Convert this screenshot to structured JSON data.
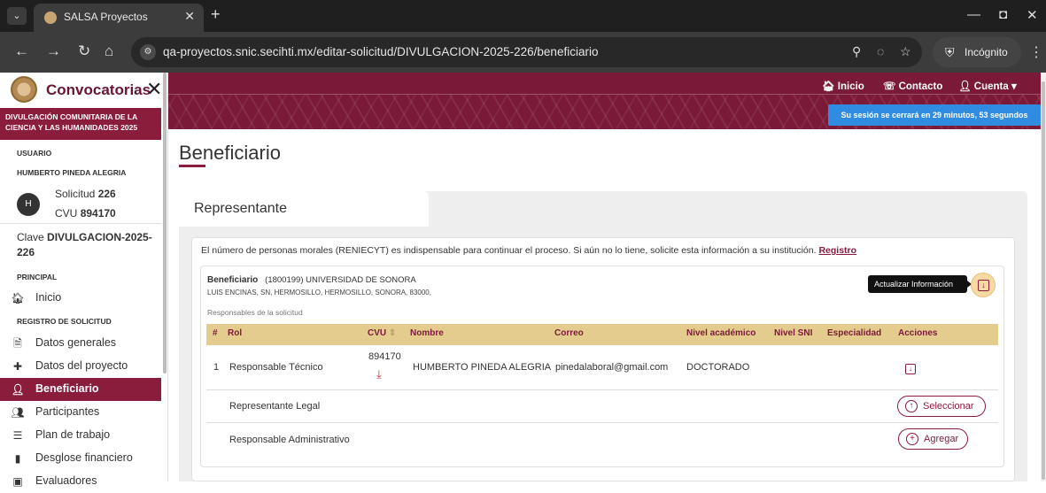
{
  "browser": {
    "tab_title": "SALSA Proyectos",
    "url": "qa-proyectos.snic.secihti.mx/editar-solicitud/DIVULGACION-2025-226/beneficiario",
    "incognito_label": "Incógnito"
  },
  "sidebar": {
    "title": "Convocatorias",
    "banner": "DIVULGACIÓN COMUNITARIA DE LA CIENCIA Y LAS HUMANIDADES 2025",
    "usuario_heading": "USUARIO",
    "user_name": "HUMBERTO PINEDA ALEGRIA",
    "avatar_initial": "H",
    "solicitud_prefix": "Solicitud",
    "solicitud_num": "226",
    "cvu_prefix": "CVU",
    "cvu_num": "894170",
    "clave_prefix": "Clave",
    "clave_value": "DIVULGACION-2025-226",
    "principal_heading": "PRINCIPAL",
    "registro_heading": "REGISTRO DE SOLICITUD",
    "items": [
      {
        "label": "Inicio"
      },
      {
        "label": "Datos generales"
      },
      {
        "label": "Datos del proyecto"
      },
      {
        "label": "Beneficiario"
      },
      {
        "label": "Participantes"
      },
      {
        "label": "Plan de trabajo"
      },
      {
        "label": "Desglose financiero"
      },
      {
        "label": "Evaluadores"
      }
    ]
  },
  "header": {
    "inicio": "Inicio",
    "contacto": "Contacto",
    "cuenta": "Cuenta",
    "session_notice": "Su sesión se cerrará en 29 minutos, 53 segundos"
  },
  "main": {
    "page_title": "Beneficiario",
    "tab_label": "Representante",
    "notice_text": "El número de personas morales (RENIECYT) es indispensable para continuar el proceso. Si aún no lo tiene, solicite esta información a su institución.",
    "notice_link": "Registro",
    "beneficiario_label": "Beneficiario",
    "beneficiario_value": "(1800199) UNIVERSIDAD DE SONORA",
    "beneficiario_address": "LUIS ENCINAS, SN, HERMOSILLO, HERMOSILLO, SONORA, 83000,",
    "responsables_label": "Responsables de la solicitud",
    "tooltip": "Actualizar Información",
    "columns": [
      "#",
      "Rol",
      "CVU",
      "Nombre",
      "Correo",
      "Nivel académico",
      "Nivel SNI",
      "Especialidad",
      "Acciones"
    ],
    "rows": [
      {
        "num": "1",
        "rol": "Responsable Técnico",
        "cvu": "894170",
        "nombre": "HUMBERTO PINEDA ALEGRIA",
        "correo": "pinedalaboral@gmail.com",
        "nivel": "DOCTORADO"
      },
      {
        "rol": "Representante Legal",
        "action": "Seleccionar"
      },
      {
        "rol": "Responsable Administrativo",
        "action": "Agregar"
      }
    ]
  },
  "colors": {
    "guinda": "#8a1c3c",
    "header": "#7b1a38",
    "gold": "#e4cc8f",
    "session_blue": "#2f8ce0"
  }
}
